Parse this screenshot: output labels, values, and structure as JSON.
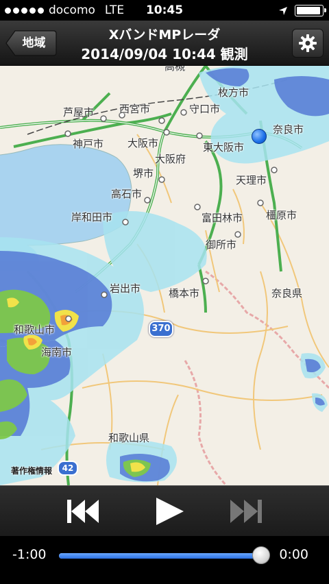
{
  "status_bar": {
    "carrier": "docomo",
    "network": "LTE",
    "time": "10:45",
    "battery_level": 0.95
  },
  "nav": {
    "back_label": "地域",
    "title": "XバンドMPレーダ",
    "subtitle": "2014/09/04 10:44 観測",
    "settings_icon": "gear-icon"
  },
  "map": {
    "places": [
      {
        "name": "守口市"
      },
      {
        "name": "枚方市"
      },
      {
        "name": "芦屋市"
      },
      {
        "name": "西宮市"
      },
      {
        "name": "奈良市"
      },
      {
        "name": "神戸市"
      },
      {
        "name": "大阪市"
      },
      {
        "name": "東大阪市"
      },
      {
        "name": "大阪府"
      },
      {
        "name": "堺市"
      },
      {
        "name": "天理市"
      },
      {
        "name": "高石市"
      },
      {
        "name": "岸和田市"
      },
      {
        "name": "富田林市"
      },
      {
        "name": "橿原市"
      },
      {
        "name": "御所市"
      },
      {
        "name": "岩出市"
      },
      {
        "name": "橋本市"
      },
      {
        "name": "奈良県"
      },
      {
        "name": "和歌山市"
      },
      {
        "name": "海南市"
      },
      {
        "name": "和歌山県"
      },
      {
        "name": "高槻"
      }
    ],
    "route_shield": "370",
    "route_shield_2": "42",
    "copyright": "著作権情報"
  },
  "playback": {
    "rewind_icon": "skip-back-icon",
    "play_icon": "play-icon",
    "forward_icon": "skip-forward-icon",
    "time_start": "-1:00",
    "time_end": "0:00",
    "progress": 0.98
  },
  "colors": {
    "sea": "#a9d3ef",
    "land": "#f3efe6",
    "road_green": "#4caf50",
    "accent_blue": "#2b6fe0"
  }
}
